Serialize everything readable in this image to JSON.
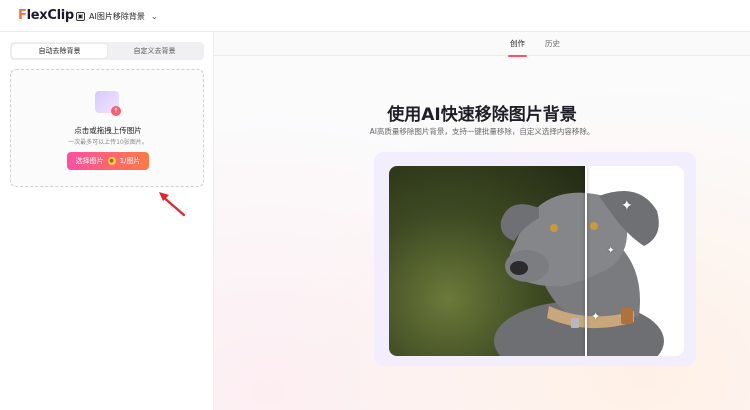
{
  "app": {
    "logo_prefix": "F",
    "logo_rest": "lexClip",
    "tool_name": "AI图片移除背景",
    "tool_icon": "image-ai-icon"
  },
  "left_panel": {
    "mode_tabs": [
      {
        "label": "自动去除背景",
        "active": true
      },
      {
        "label": "自定义去背景",
        "active": false
      }
    ],
    "dropzone": {
      "title": "点击或拖拽上传图片",
      "subtitle": "一次最多可以上传10张图片。",
      "button_label": "选择图片",
      "credit_text": "1/图片"
    }
  },
  "main": {
    "tabs": [
      {
        "label": "创作",
        "active": true
      },
      {
        "label": "历史",
        "active": false
      }
    ],
    "hero_title": "使用AI快速移除图片背景",
    "hero_subtitle": "AI高质量移除图片背景，支持一键批量移除，自定义选择内容移除。"
  },
  "colors": {
    "accent": "#ff4f6a",
    "button_gradient_start": "#ff4fa0",
    "button_gradient_end": "#ff7a45",
    "annotation_arrow": "#e0242c"
  }
}
